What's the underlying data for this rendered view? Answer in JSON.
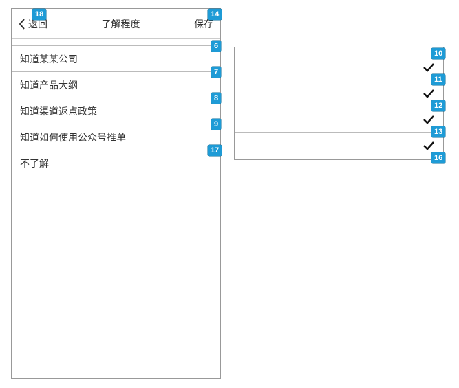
{
  "header": {
    "back_label": "返回",
    "title": "了解程度",
    "save_label": "保存"
  },
  "leftList": {
    "items": [
      {
        "label": "知道某某公司"
      },
      {
        "label": "知道产品大纲"
      },
      {
        "label": "知道渠道返点政策"
      },
      {
        "label": "知道如何使用公众号推单"
      },
      {
        "label": "不了解"
      }
    ]
  },
  "rightList": {
    "items": [
      {
        "checked": true
      },
      {
        "checked": true
      },
      {
        "checked": true
      },
      {
        "checked": true
      }
    ]
  },
  "badges": {
    "header_back": "18",
    "header_save": "14",
    "left_row0": "6",
    "left_row1": "7",
    "left_row2": "8",
    "left_row3": "9",
    "left_row4": "17",
    "right_top": "10",
    "right_row0": "11",
    "right_row1": "12",
    "right_row2": "13",
    "right_row3": "16"
  },
  "colors": {
    "badge_bg": "#1e9bd6"
  }
}
